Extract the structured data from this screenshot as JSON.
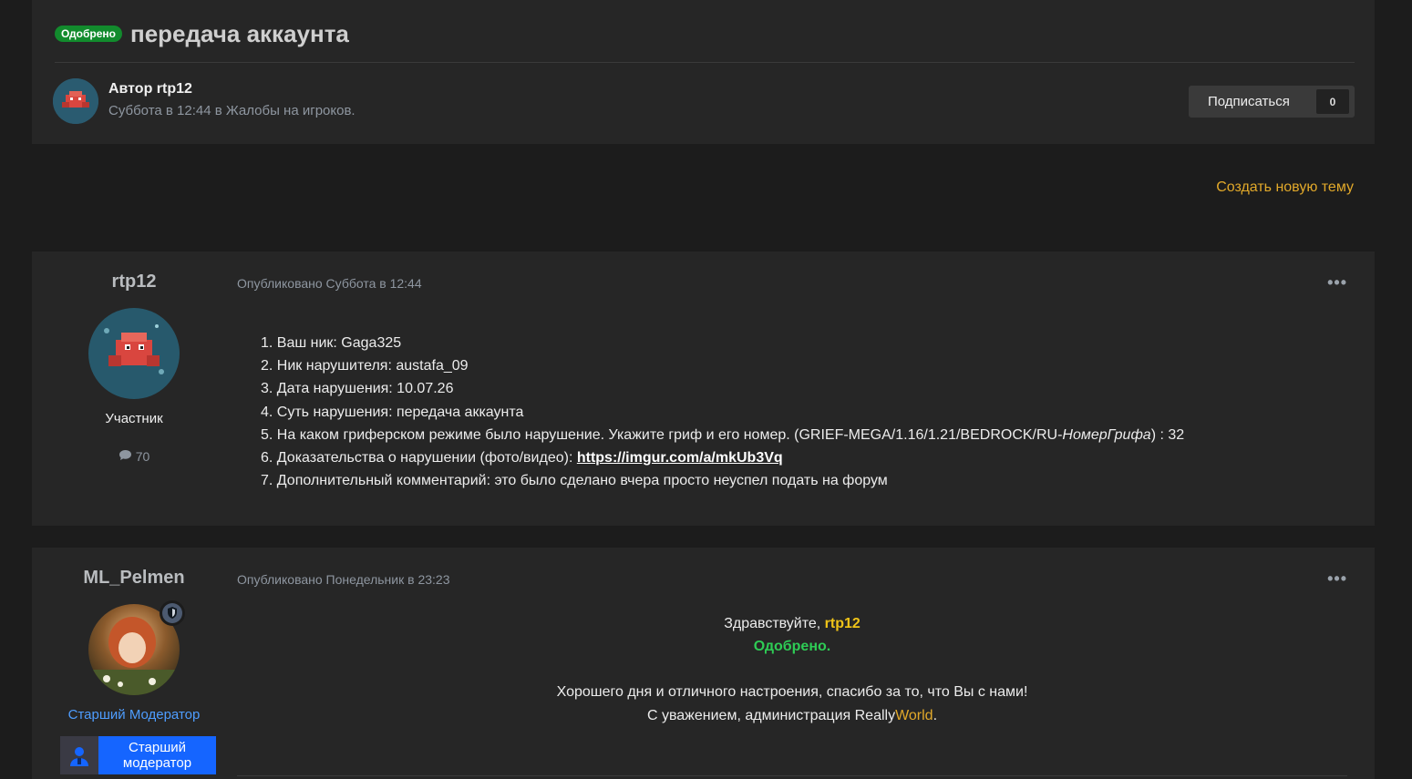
{
  "topic": {
    "status_badge": "Одобрено",
    "title": "передача аккаунта",
    "author_line": "Автор rtp12",
    "meta_line": "Суббота в 12:44 в Жалобы на игроков.",
    "follow_label": "Подписаться",
    "follow_count": "0",
    "new_topic_link": "Создать новую тему"
  },
  "posts": [
    {
      "author": "rtp12",
      "role": "Участник",
      "post_count": "70",
      "published": "Опубликовано Суббота в 12:44",
      "menu": "•••",
      "lines": [
        "1. Ваш ник: Gaga325",
        "2. Ник нарушителя: austafa_09",
        "3. Дата нарушения: 10.07.26",
        "4. Суть нарушения: передача аккаунта",
        "5. На каком гриферском режиме было нарушение. Укажите гриф и его номер. (GRIEF-MEGA/1.16/1.21/BEDROCK/RU-",
        "6. Доказательства о нарушении (фото/видео): ",
        "7. Дополнительный комментарий: это было сделано вчера просто неуспел подать на форум"
      ],
      "line5_italic": "НомерГрифа",
      "line5_tail": ") : 32",
      "proof_link": "https://imgur.com/a/mkUb3Vq"
    },
    {
      "author": "ML_Pelmen",
      "role": "Старший Модератор",
      "badge_text": "Старший модератор",
      "published": "Опубликовано Понедельник в 23:23",
      "menu": "•••",
      "greeting": "Здравствуйте, ",
      "greeting_name": "rtp12",
      "verdict": "Одобрено.",
      "closing1": "Хорошего дня и отличного настроения, спасибо за то, что Вы с нами!",
      "closing2_prefix": "С уважением, администрация Really",
      "closing2_brand": "World",
      "closing2_suffix": "."
    }
  ],
  "colors": {
    "accent_orange": "#e2a92a",
    "approved_green": "#128b2d",
    "verdict_green": "#2ecc55",
    "name_yellow": "#f0c418",
    "role_blue": "#4e9dff",
    "badge_blue": "#1565ff"
  },
  "icons": [
    "comment-icon",
    "shield-icon",
    "moderator-icon",
    "more-icon"
  ]
}
